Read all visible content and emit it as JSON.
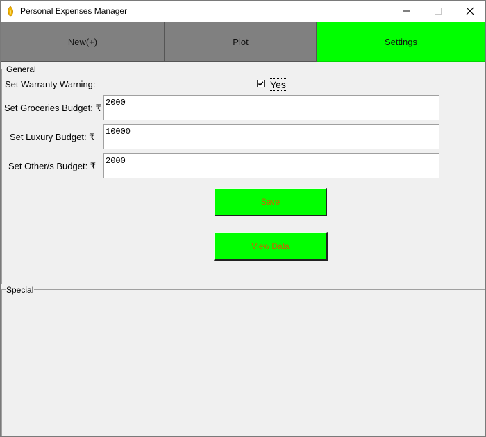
{
  "window": {
    "title": "Personal Expenses Manager",
    "icon": "flame-icon"
  },
  "tabs": [
    {
      "label": "New(+)",
      "active": false,
      "color": "#808080"
    },
    {
      "label": "Plot",
      "active": false,
      "color": "#808080"
    },
    {
      "label": "Settings",
      "active": true,
      "color": "#00ff00"
    }
  ],
  "general": {
    "legend": "General",
    "warranty_label": "Set Warranty Warning:",
    "warranty_checkbox": {
      "checked": true,
      "label": "Yes"
    },
    "groceries_label": "Set Groceries Budget: ₹",
    "groceries_value": "2000",
    "luxury_label": "Set Luxury Budget: ₹",
    "luxury_value": "10000",
    "others_label": "Set Other/s Budget: ₹",
    "others_value": "2000",
    "save_label": "Save",
    "view_data_label": "View Data",
    "button_color": "#00ff00",
    "button_text_color": "#c86400"
  },
  "special": {
    "legend": "Special"
  }
}
